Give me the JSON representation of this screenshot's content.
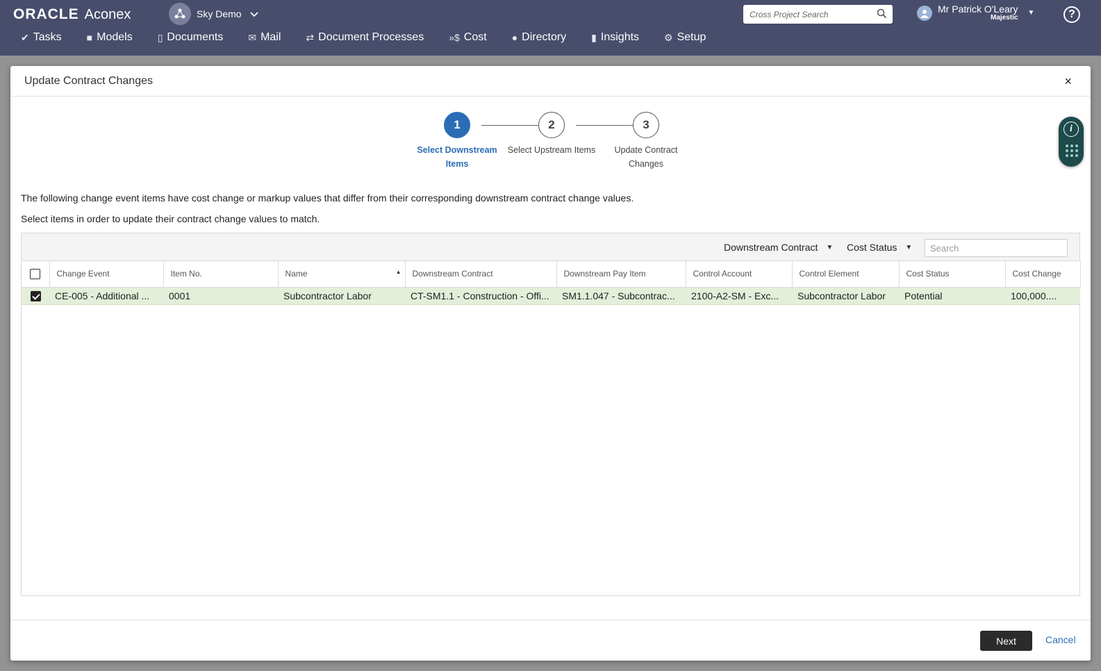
{
  "header": {
    "brand_oracle": "ORACLE",
    "brand_aconex": "Aconex",
    "project_name": "Sky Demo",
    "cross_search_placeholder": "Cross Project Search",
    "user_name": "Mr Patrick O'Leary",
    "user_org": "Majestic",
    "help_label": "?"
  },
  "nav": [
    {
      "label": "Tasks",
      "icon": "check-icon"
    },
    {
      "label": "Models",
      "icon": "cube-icon"
    },
    {
      "label": "Documents",
      "icon": "document-icon"
    },
    {
      "label": "Mail",
      "icon": "mail-icon"
    },
    {
      "label": "Document Processes",
      "icon": "workflow-icon"
    },
    {
      "label": "Cost",
      "icon": "cost-icon"
    },
    {
      "label": "Directory",
      "icon": "people-icon"
    },
    {
      "label": "Insights",
      "icon": "chart-icon"
    },
    {
      "label": "Setup",
      "icon": "gear-icon"
    }
  ],
  "modal": {
    "title": "Update Contract Changes",
    "close": "×",
    "steps": [
      {
        "number": "1",
        "label": "Select Downstream Items",
        "active": true
      },
      {
        "number": "2",
        "label": "Select Upstream Items",
        "active": false
      },
      {
        "number": "3",
        "label": "Update Contract Changes",
        "active": false
      }
    ],
    "intro_line1": "The following change event items have cost change or markup values that differ from their corresponding downstream contract change values.",
    "intro_line2": "Select items in order to update their contract change values to match.",
    "filters": {
      "downstream_contract": "Downstream Contract",
      "cost_status": "Cost Status",
      "search_placeholder": "Search"
    },
    "columns": [
      "Change Event",
      "Item No.",
      "Name",
      "Downstream Contract",
      "Downstream Pay Item",
      "Control Account",
      "Control Element",
      "Cost Status",
      "Cost Change"
    ],
    "rows": [
      {
        "selected": true,
        "change_event": "CE-005 - Additional ...",
        "item_no": "0001",
        "name": "Subcontractor Labor",
        "downstream_contract": "CT-SM1.1 - Construction - Offi...",
        "downstream_pay_item": "SM1.1.047 - Subcontrac...",
        "control_account": "2100-A2-SM - Exc...",
        "control_element": "Subcontractor Labor",
        "cost_status": "Potential",
        "cost_change": "100,000...."
      }
    ],
    "next_label": "Next",
    "cancel_label": "Cancel"
  }
}
